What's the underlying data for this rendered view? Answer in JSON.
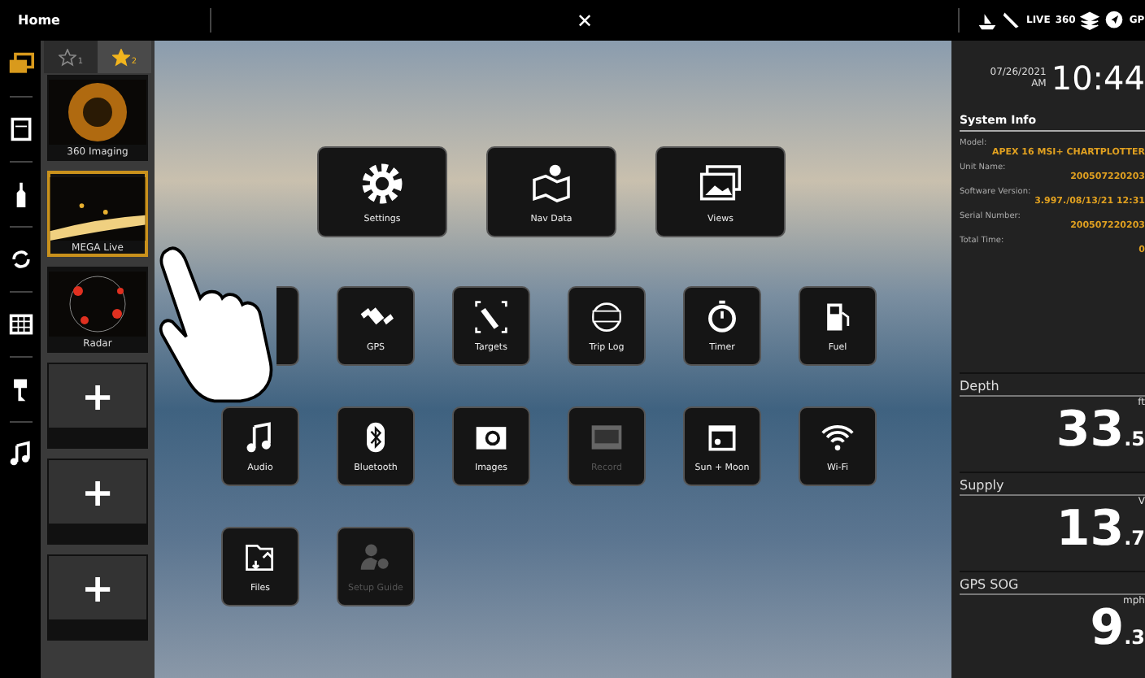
{
  "top_bar": {
    "title": "Home",
    "close": "✕",
    "indicators": [
      "LIVE",
      "360",
      "GP"
    ]
  },
  "favorites": {
    "tabs": [
      {
        "number": "1",
        "selected": false
      },
      {
        "number": "2",
        "selected": true
      }
    ],
    "items": [
      {
        "kind": "app",
        "label": "360 Imaging",
        "selected": false
      },
      {
        "kind": "app",
        "label": "MEGA Live",
        "selected": true
      },
      {
        "kind": "app",
        "label": "Radar",
        "selected": false
      },
      {
        "kind": "add",
        "label": "+",
        "selected": false
      },
      {
        "kind": "add",
        "label": "+",
        "selected": false
      },
      {
        "kind": "add",
        "label": "+",
        "selected": false
      }
    ]
  },
  "apps": [
    [
      {
        "label": "Settings",
        "disabled": false
      },
      {
        "label": "Nav Data",
        "disabled": false
      },
      {
        "label": "Views",
        "disabled": false
      }
    ],
    [
      {
        "kind": "partial"
      },
      {
        "label": "GPS",
        "disabled": false
      },
      {
        "label": "Targets",
        "disabled": false
      },
      {
        "label": "Trip Log",
        "disabled": false
      },
      {
        "label": "Timer",
        "disabled": false
      },
      {
        "label": "Fuel",
        "disabled": false
      }
    ],
    [
      {
        "label": "Audio",
        "disabled": false
      },
      {
        "label": "Bluetooth",
        "disabled": false
      },
      {
        "label": "Images",
        "disabled": false
      },
      {
        "label": "Record",
        "disabled": true
      },
      {
        "label": "Sun + Moon",
        "disabled": false
      },
      {
        "label": "Wi-Fi",
        "disabled": false
      }
    ],
    [
      {
        "label": "Files",
        "disabled": false
      },
      {
        "label": "Setup Guide",
        "disabled": true
      }
    ]
  ],
  "clock": {
    "date": "07/26/2021",
    "ampm": "AM",
    "time": "10:44"
  },
  "system_info": {
    "title": "System Info",
    "fields": [
      {
        "label": "Model:",
        "value": "APEX 16 MSI+ CHARTPLOTTER"
      },
      {
        "label": "Unit Name:",
        "value": "200507220203"
      },
      {
        "label": "Software Version:",
        "value": "3.997./08/13/21 12:31"
      },
      {
        "label": "Serial Number:",
        "value": "200507220203"
      },
      {
        "label": "Total Time:",
        "value": "0"
      }
    ]
  },
  "gauges": [
    {
      "title": "Depth",
      "unit": "ft",
      "whole": "33",
      "decimal": ".5"
    },
    {
      "title": "Supply",
      "unit": "V",
      "whole": "13",
      "decimal": ".7"
    },
    {
      "title": "GPS SOG",
      "unit": "mph",
      "whole": "9",
      "decimal": ".3"
    }
  ]
}
